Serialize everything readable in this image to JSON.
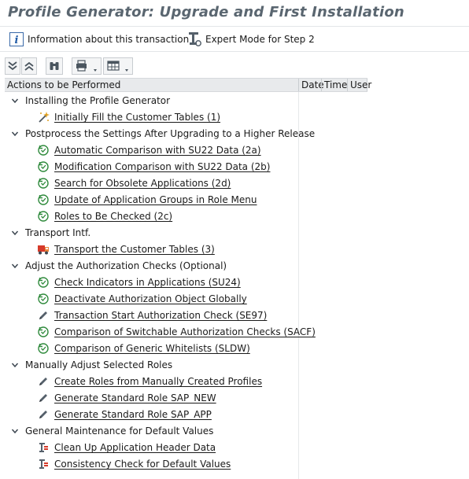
{
  "title": "Profile Generator: Upgrade and First Installation",
  "toolbar": {
    "info_label": "Information about this transaction",
    "expert_label": "Expert Mode for Step 2"
  },
  "toolbar2": {
    "buttons": [
      "expand-all",
      "collapse-all",
      "find",
      "print",
      "layout"
    ]
  },
  "columns": {
    "actions": "Actions to be Performed",
    "date": "Date",
    "time": "Time",
    "user": "User"
  },
  "tree": [
    {
      "label": "Installing the Profile Generator",
      "items": [
        {
          "label": "Initially Fill the Customer Tables (1)",
          "icon": "wand-icon"
        }
      ]
    },
    {
      "label": "Postprocess the Settings After Upgrading to a Higher Release",
      "items": [
        {
          "label": "Automatic Comparison with SU22 Data (2a)",
          "icon": "refresh-icon"
        },
        {
          "label": "Modification Comparison with SU22 Data (2b)",
          "icon": "refresh-icon"
        },
        {
          "label": "Search for Obsolete Applications (2d)",
          "icon": "refresh-icon"
        },
        {
          "label": "Update of Application Groups in Role Menu",
          "icon": "refresh-icon"
        },
        {
          "label": "Roles to Be Checked (2c)",
          "icon": "refresh-icon"
        }
      ]
    },
    {
      "label": "Transport Intf.",
      "items": [
        {
          "label": "Transport the Customer Tables (3)",
          "icon": "truck-icon"
        }
      ]
    },
    {
      "label": "Adjust the Authorization Checks (Optional)",
      "items": [
        {
          "label": "Check Indicators in Applications (SU24)",
          "icon": "refresh-icon"
        },
        {
          "label": "Deactivate Authorization Object Globally",
          "icon": "refresh-icon"
        },
        {
          "label": "Transaction Start Authorization Check (SE97)",
          "icon": "pencil-icon"
        },
        {
          "label": "Comparison of Switchable Authorization Checks (SACF)",
          "icon": "refresh-icon"
        },
        {
          "label": "Comparison of Generic Whitelists (SLDW)",
          "icon": "refresh-icon"
        }
      ]
    },
    {
      "label": "Manually Adjust Selected Roles",
      "items": [
        {
          "label": "Create Roles from Manually Created Profiles",
          "icon": "pencil-icon"
        },
        {
          "label": "Generate Standard Role SAP_NEW",
          "icon": "pencil-icon"
        },
        {
          "label": "Generate Standard Role SAP_APP",
          "icon": "pencil-icon"
        }
      ]
    },
    {
      "label": "General Maintenance for Default Values",
      "items": [
        {
          "label": "Clean Up Application Header Data",
          "icon": "tool-icon"
        },
        {
          "label": "Consistency Check for Default Values",
          "icon": "tool-icon"
        }
      ]
    }
  ]
}
